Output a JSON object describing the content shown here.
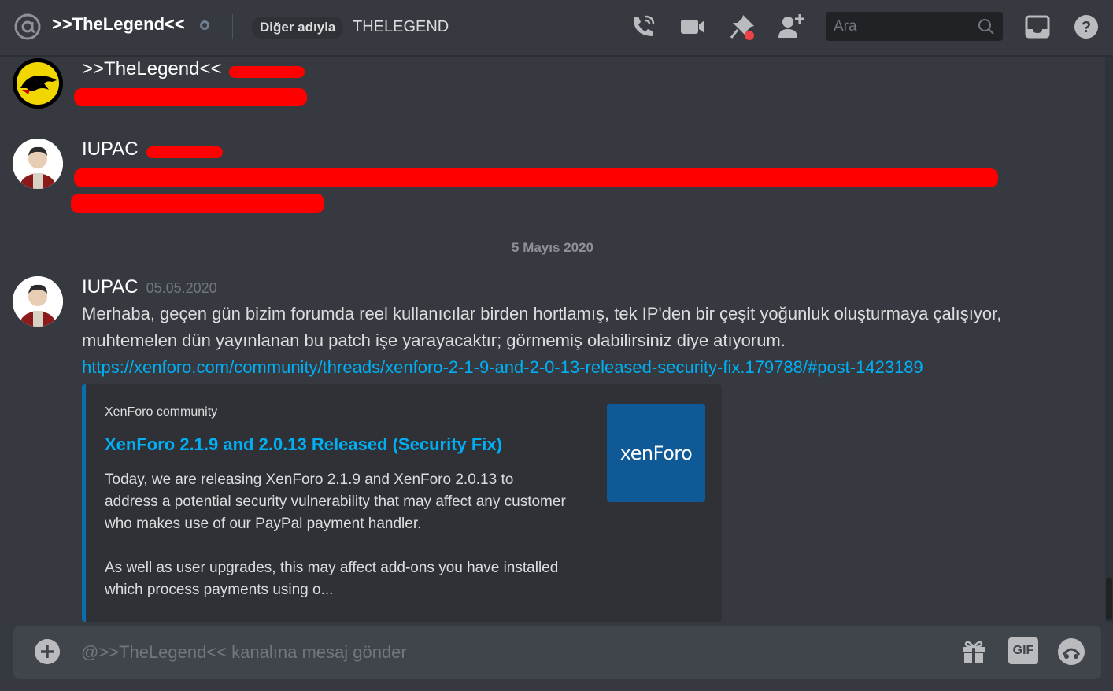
{
  "header": {
    "channel_name": ">>TheLegend<<",
    "alias_label": "Diğer adıyla",
    "alias_value": "THELEGEND",
    "search_placeholder": "Ara",
    "icons": [
      "at-icon",
      "status-offline-icon",
      "phone-call-icon",
      "video-camera-icon",
      "pin-icon",
      "add-friend-icon",
      "search-icon",
      "inbox-icon",
      "help-icon"
    ]
  },
  "messages": [
    {
      "author": ">>TheLegend<<",
      "redacted": true
    },
    {
      "author": "IUPAC",
      "redacted": true
    },
    {
      "author": "IUPAC",
      "timestamp": "05.05.2020",
      "text": "Merhaba, geçen gün bizim forumda reel kullanıcılar birden hortlamış, tek IP'den bir çeşit yoğunluk oluşturmaya çalışıyor, muhtemelen dün yayınlanan bu patch işe yarayacaktır; görmemiş olabilirsiniz diye atıyorum.",
      "link": "https://xenforo.com/community/threads/xenforo-2-1-9-and-2-0-13-released-security-fix.179788/#post-1423189"
    }
  ],
  "day_separator": "5 Mayıs 2020",
  "embed": {
    "provider": "XenForo community",
    "title": "XenForo 2.1.9 and 2.0.13 Released (Security Fix)",
    "description_p1": "Today, we are releasing XenForo 2.1.9 and XenForo 2.0.13 to address a potential security vulnerability that may affect any customer who makes use of our PayPal payment handler.",
    "description_p2": "As well as user upgrades, this may affect add-ons you have installed which process payments using o...",
    "thumbnail_text": "xenForo",
    "accent_color": "#0a6dac"
  },
  "composer": {
    "placeholder": "@>>TheLegend<< kanalına mesaj gönder",
    "gif_label": "GIF",
    "icons": [
      "add-attachment-icon",
      "gift-icon",
      "gif-icon",
      "emoji-icon"
    ]
  },
  "colors": {
    "background": "#36393f",
    "link": "#00b0f4",
    "redaction": "#ff0000"
  }
}
